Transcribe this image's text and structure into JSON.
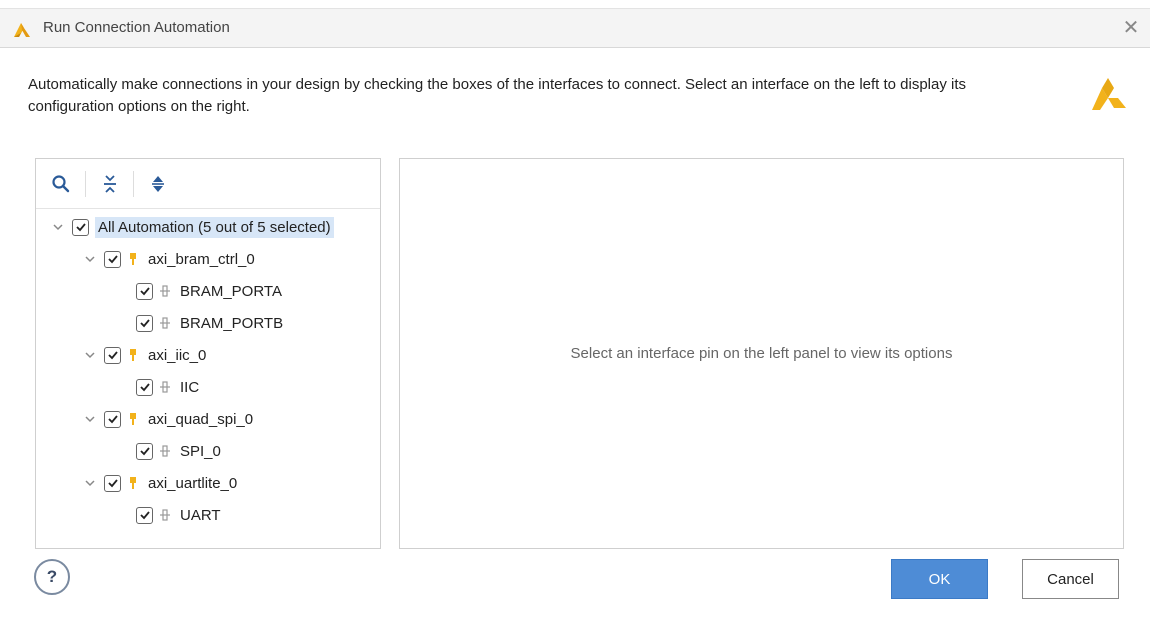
{
  "window": {
    "title": "Run Connection Automation",
    "close_glyph": "✕"
  },
  "description": "Automatically make connections in your design by checking the boxes of the interfaces to connect. Select an interface on the left to display its configuration options on the right.",
  "toolbar": {
    "icons": [
      "search-icon",
      "collapse-all-icon",
      "expand-all-icon"
    ]
  },
  "tree": {
    "root": {
      "label": "All Automation (5 out of 5 selected)",
      "checked": true,
      "expanded": true
    },
    "groups": [
      {
        "label": "axi_bram_ctrl_0",
        "checked": true,
        "expanded": true,
        "children": [
          {
            "label": "BRAM_PORTA",
            "checked": true
          },
          {
            "label": "BRAM_PORTB",
            "checked": true
          }
        ]
      },
      {
        "label": "axi_iic_0",
        "checked": true,
        "expanded": true,
        "children": [
          {
            "label": "IIC",
            "checked": true
          }
        ]
      },
      {
        "label": "axi_quad_spi_0",
        "checked": true,
        "expanded": true,
        "children": [
          {
            "label": "SPI_0",
            "checked": true
          }
        ]
      },
      {
        "label": "axi_uartlite_0",
        "checked": true,
        "expanded": true,
        "children": [
          {
            "label": "UART",
            "checked": true
          }
        ]
      }
    ]
  },
  "right_panel": {
    "placeholder": "Select an interface pin on the left panel to view its options"
  },
  "footer": {
    "help_label": "?",
    "ok_label": "OK",
    "cancel_label": "Cancel"
  },
  "colors": {
    "ok_button": "#4e8cd6",
    "selection": "#d7e6f7",
    "ip_icon": "#f2b21b",
    "logo": "#f2b21b"
  }
}
